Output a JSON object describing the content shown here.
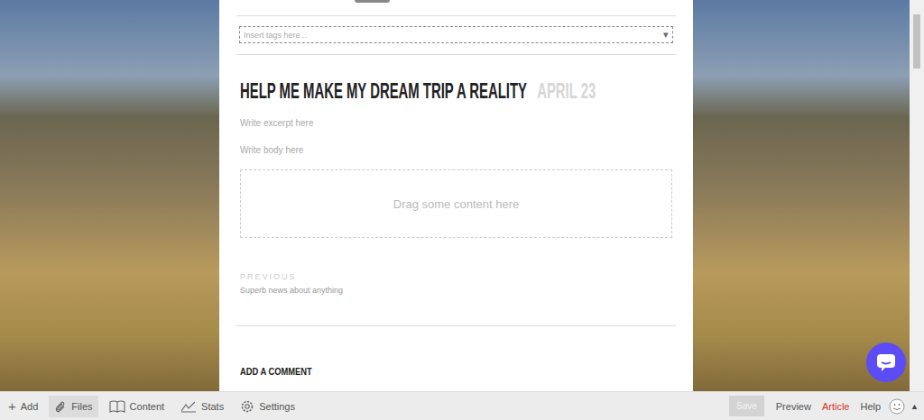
{
  "editor": {
    "tags_placeholder": "Insert tags here...",
    "dropdown_icon": "▾",
    "title": "HELP ME MAKE MY DREAM TRIP A REALITY",
    "date": "APRIL 23",
    "excerpt_placeholder": "Write excerpt here",
    "body_placeholder": "Write body here",
    "dropzone": "Drag some content here",
    "previous_label": "PREVIOUS",
    "previous_title": "Superb news about anything",
    "comment_heading": "ADD A COMMENT"
  },
  "toolbar": {
    "left": [
      {
        "label": "Add",
        "icon": "+",
        "selected": false
      },
      {
        "label": "Files",
        "icon": "",
        "selected": true
      },
      {
        "label": "Content",
        "icon": "",
        "selected": false
      },
      {
        "label": "Stats",
        "icon": "",
        "selected": false
      },
      {
        "label": "Settings",
        "icon": "",
        "selected": false
      }
    ],
    "save": {
      "label": "Save",
      "disabled": true
    },
    "right": [
      {
        "label": "Preview",
        "selected": false
      },
      {
        "label": "Article",
        "selected": true
      },
      {
        "label": "Help",
        "selected": false
      }
    ],
    "menu_arrow": "▲"
  }
}
